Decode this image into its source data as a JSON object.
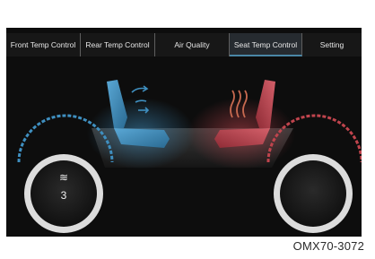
{
  "tabs": [
    {
      "label": "Front Temp Control"
    },
    {
      "label": "Rear Temp Control"
    },
    {
      "label": "Air Quality"
    },
    {
      "label": "Seat Temp Control"
    },
    {
      "label": "Setting"
    }
  ],
  "active_tab": "Seat Temp Control",
  "left_knob": {
    "symbol": "≋",
    "level": "3"
  },
  "caption": "OMX70-3072",
  "colors": {
    "cool": "#3f8fc0",
    "heat": "#c0444d",
    "background": "#0d0d0d",
    "accent": "#4a86a6"
  }
}
